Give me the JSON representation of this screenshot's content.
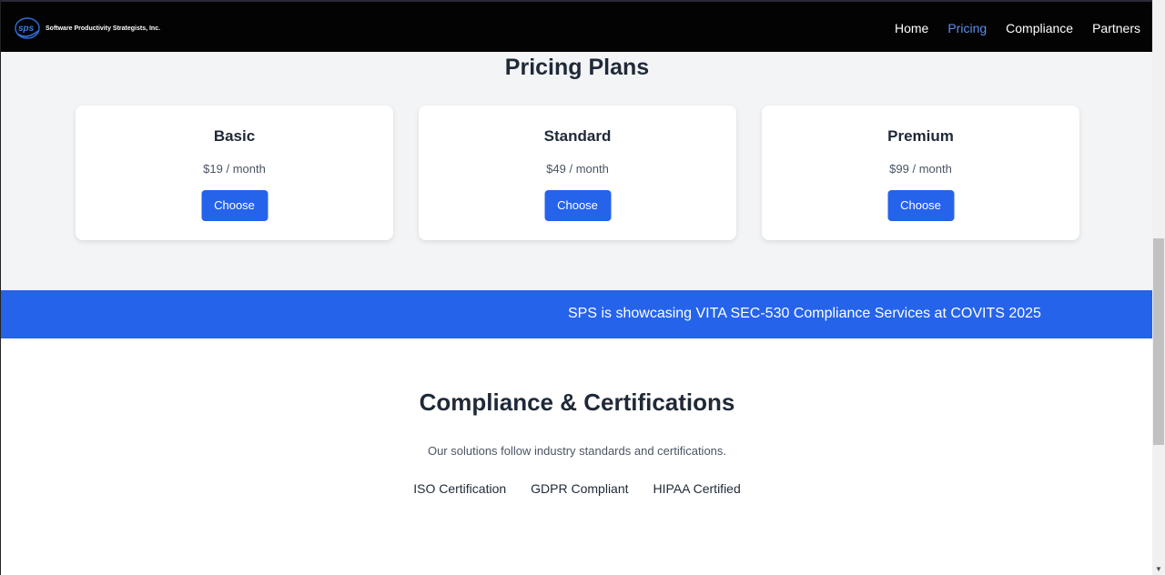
{
  "header": {
    "brand_name": "Software Productivity Strategists, Inc.",
    "logo_text": "sps",
    "nav": [
      {
        "label": "Home",
        "active": false
      },
      {
        "label": "Pricing",
        "active": true
      },
      {
        "label": "Compliance",
        "active": false
      },
      {
        "label": "Partners",
        "active": false
      }
    ]
  },
  "pricing": {
    "title": "Pricing Plans",
    "plans": [
      {
        "name": "Basic",
        "price": "$19 / month",
        "button": "Choose"
      },
      {
        "name": "Standard",
        "price": "$49 / month",
        "button": "Choose"
      },
      {
        "name": "Premium",
        "price": "$99 / month",
        "button": "Choose"
      }
    ]
  },
  "banner": {
    "text": "SPS is showcasing VITA SEC-530 Compliance Services at COVITS 2025"
  },
  "compliance": {
    "title": "Compliance & Certifications",
    "description": "Our solutions follow industry standards and certifications.",
    "certifications": [
      "ISO Certification",
      "GDPR Compliant",
      "HIPAA Certified"
    ]
  },
  "colors": {
    "header_bg": "#030303",
    "accent": "#2563eb",
    "nav_active": "#5b8ff0",
    "section_bg": "#f3f4f6"
  }
}
